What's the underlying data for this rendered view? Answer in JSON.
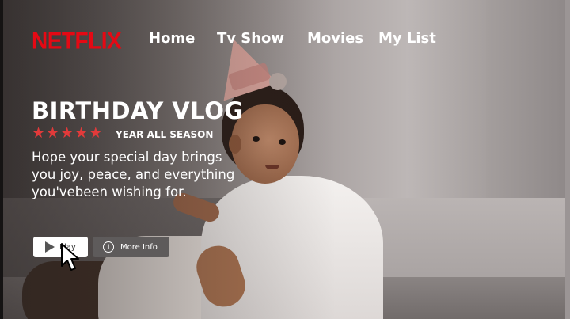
{
  "brand": {
    "logo_text": "NETFLIX",
    "color": "#e50914"
  },
  "nav": {
    "home": "Home",
    "tv_show": "Tv Show",
    "movies": "Movies",
    "my_list": "My List"
  },
  "hero": {
    "title": "BIRTHDAY VLOG",
    "rating_stars": 5,
    "star_color": "#e23a3a",
    "season_label": "YEAR ALL SEASON",
    "description_lines": [
      "Hope your special day brings",
      "you joy, peace, and everything",
      "you'vebeen wishing for."
    ]
  },
  "buttons": {
    "play_label": "Play",
    "play_icon": "play-icon",
    "info_label": "More Info",
    "info_icon": "info-icon"
  }
}
